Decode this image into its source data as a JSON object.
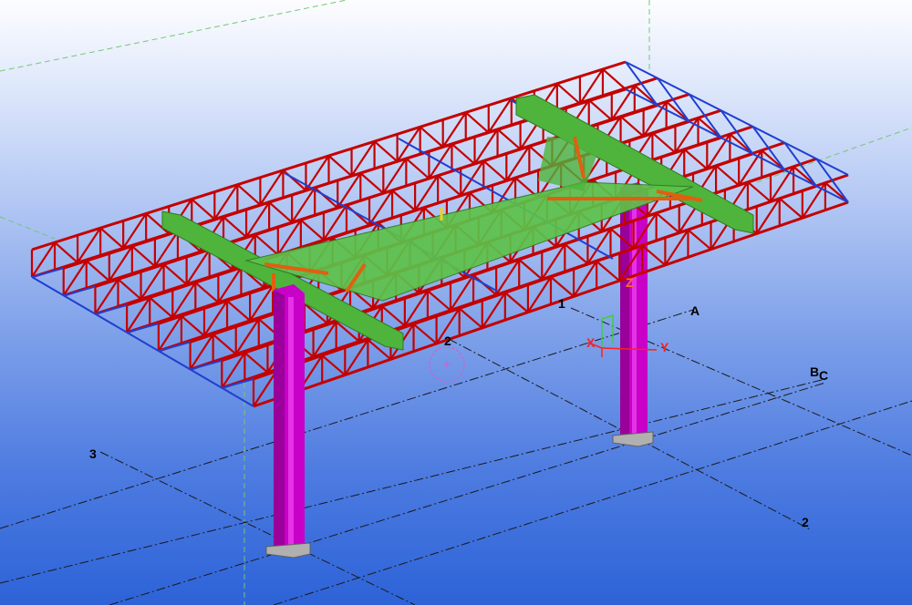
{
  "app": {
    "view_type": "3D model view",
    "background_gradient": [
      "#fdfdff",
      "#b1c6f3",
      "#2d63d8"
    ]
  },
  "grid_labels": {
    "row_1": "1",
    "row_2_near": "2",
    "row_2_far": "2",
    "row_3": "3",
    "col_A": "A",
    "col_B": "B",
    "col_C": "C"
  },
  "coordinate_symbol": {
    "x_label": "X",
    "y_label": "Y",
    "z_label": "Z"
  },
  "colors": {
    "truss_chord": "#c40000",
    "truss_bracing": "#1f3fd0",
    "main_beam": "#4fb43c",
    "column": "#d400d4",
    "base_plate": "#b0b0b0",
    "connection_plate": "#e06010",
    "gridline": "#1a1a1a",
    "green_guide": "#7fd47f",
    "axis_red": "#ff2020"
  },
  "icons": [
    "grid-lines",
    "coordinate-axes-icon",
    "rotation-center-icon"
  ]
}
